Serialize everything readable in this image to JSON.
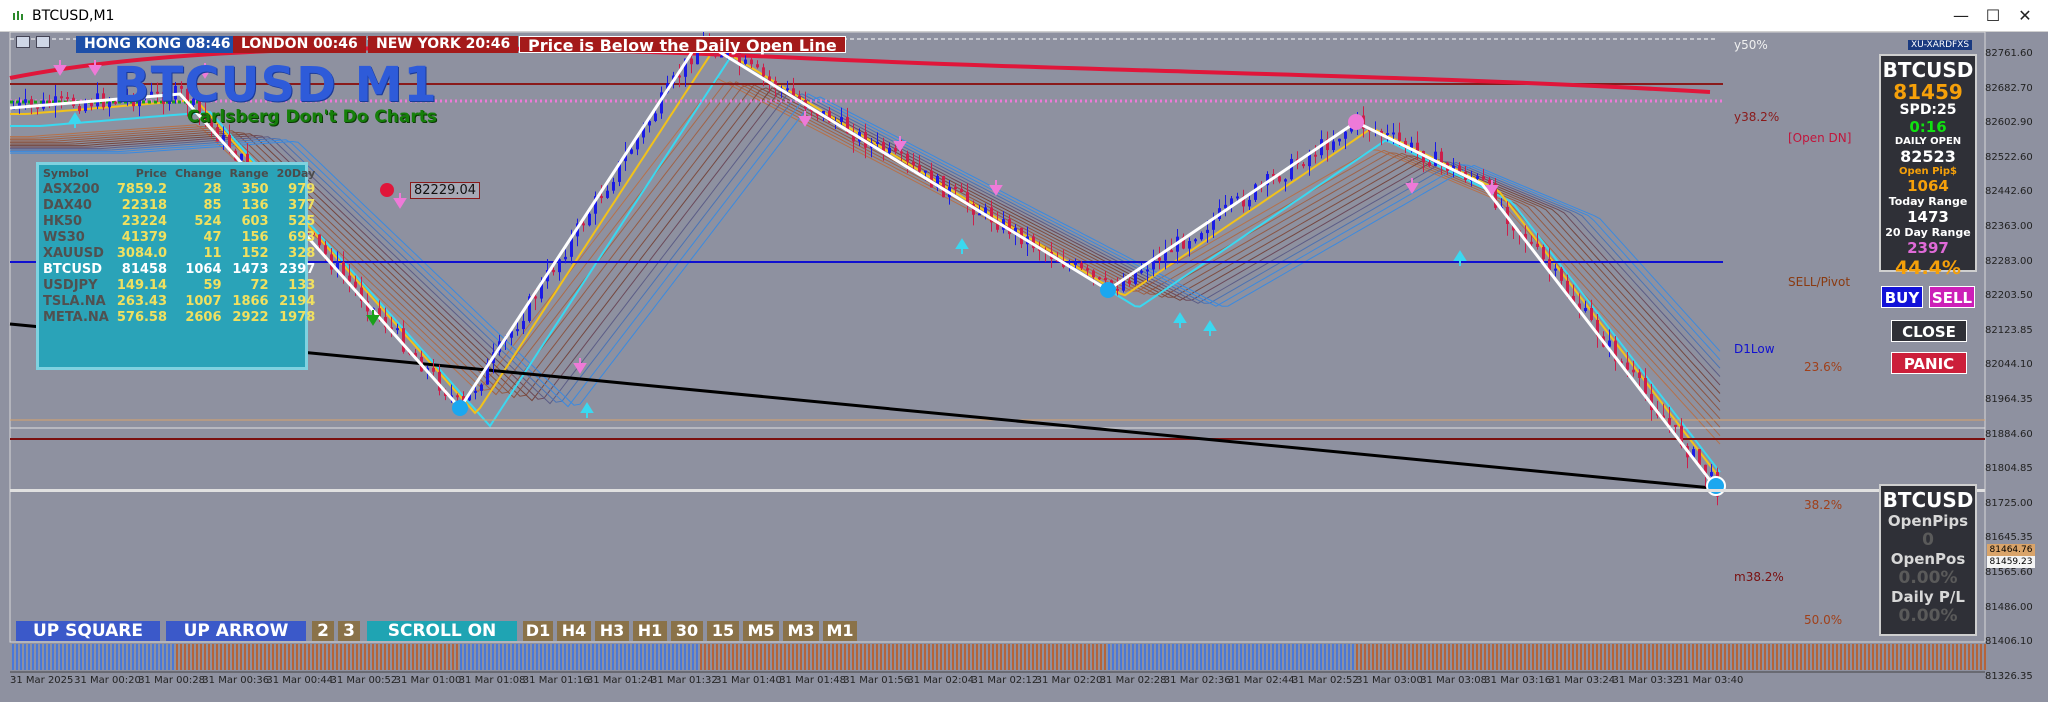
{
  "window": {
    "title": "BTCUSD,M1",
    "minimize": "—",
    "maximize": "☐",
    "close": "✕"
  },
  "clocks": [
    {
      "label": "HONG KONG 08:46",
      "color": "#1e4fa8"
    },
    {
      "label": "LONDON  00:46",
      "color": "#a41a1a"
    },
    {
      "label": "NEW YORK  20:46",
      "color": "#a41a1a"
    }
  ],
  "alert": "Price is Below the Daily Open Line",
  "chart_title": "BTCUSD M1",
  "chart_subtitle": "Carlsberg Don't Do Charts",
  "broker": "XU-XARDFXS",
  "price_callout": "82229.04",
  "symbol_table": {
    "headers": [
      "Symbol",
      "Price",
      "Change",
      "Range",
      "20Day"
    ],
    "rows": [
      [
        "ASX200",
        "7859.2",
        "28",
        "350",
        "979"
      ],
      [
        "DAX40",
        "22318",
        "85",
        "136",
        "377"
      ],
      [
        "HK50",
        "23224",
        "524",
        "603",
        "525"
      ],
      [
        "WS30",
        "41379",
        "47",
        "156",
        "693"
      ],
      [
        "XAUUSD",
        "3084.0",
        "11",
        "152",
        "328"
      ],
      [
        "BTCUSD",
        "81458",
        "1064",
        "1473",
        "2397"
      ],
      [
        "USDJPY",
        "149.14",
        "59",
        "72",
        "133"
      ],
      [
        "TSLA.NA",
        "263.43",
        "1007",
        "1866",
        "2194"
      ],
      [
        "META.NA",
        "576.58",
        "2606",
        "2922",
        "1978"
      ]
    ],
    "highlight_row": 5
  },
  "bottom_buttons": {
    "up_square": "UP SQUARE",
    "up_arrow": "UP ARROW",
    "two": "2",
    "three": "3",
    "scroll": "SCROLL ON",
    "timeframes": [
      "D1",
      "H4",
      "H3",
      "H1",
      "30",
      "15",
      "M5",
      "M3",
      "M1"
    ]
  },
  "levels": {
    "y50": "y50%",
    "y382": "y38.2%",
    "open_dn": "[Open DN]",
    "sell_pivot": "SELL/Pivot",
    "d1low": "D1Low",
    "fib236": "23.6%",
    "fib382": "38.2%",
    "m382": "m38.2%",
    "fib50": "50.0%"
  },
  "price_axis": [
    "82761.60",
    "82682.70",
    "82602.90",
    "82522.60",
    "82442.60",
    "82363.00",
    "82283.00",
    "82203.50",
    "82123.85",
    "82044.10",
    "81964.35",
    "81884.60",
    "81804.85",
    "81725.00",
    "81645.35",
    "81565.60",
    "81486.00",
    "81406.10",
    "81326.35"
  ],
  "price_axis_tags": {
    "ask": "81464.76",
    "bid": "81459.23"
  },
  "time_axis": [
    "31 Mar 2025",
    "31 Mar 00:20",
    "31 Mar 00:28",
    "31 Mar 00:36",
    "31 Mar 00:44",
    "31 Mar 00:52",
    "31 Mar 01:00",
    "31 Mar 01:08",
    "31 Mar 01:16",
    "31 Mar 01:24",
    "31 Mar 01:32",
    "31 Mar 01:40",
    "31 Mar 01:48",
    "31 Mar 01:56",
    "31 Mar 02:04",
    "31 Mar 02:12",
    "31 Mar 02:20",
    "31 Mar 02:28",
    "31 Mar 02:36",
    "31 Mar 02:44",
    "31 Mar 02:52",
    "31 Mar 03:00",
    "31 Mar 03:08",
    "31 Mar 03:16",
    "31 Mar 03:24",
    "31 Mar 03:32",
    "31 Mar 03:40"
  ],
  "info_panel": {
    "symbol": "BTCUSD",
    "price": "81459",
    "spread": "SPD:25",
    "timer": "0:16",
    "daily_open_label": "DAILY OPEN",
    "daily_open": "82523",
    "open_pips_label": "Open Pip$",
    "open_pips": "1064",
    "today_range_label": "Today Range",
    "today_range": "1473",
    "day20_label": "20 Day Range",
    "day20": "2397",
    "pct": "44.4%"
  },
  "trade_buttons": {
    "buy": "BUY",
    "sell": "SELL",
    "close": "CLOSE",
    "panic": "PANIC"
  },
  "position_panel": {
    "symbol": "BTCUSD",
    "open_pips_label": "OpenPips",
    "open_pips": "0",
    "open_pos_label": "OpenPos",
    "open_pos": "0.00%",
    "daily_pl_label": "Daily P/L",
    "daily_pl": "0.00%"
  },
  "colors": {
    "chart_bg": "#8e91a0",
    "bull": "#1a1ae6",
    "bear": "#cc1f4a",
    "ema_yellow": "#f2c21a",
    "ema_cyan": "#3ad8f0",
    "zigzag": "#ffffff"
  }
}
